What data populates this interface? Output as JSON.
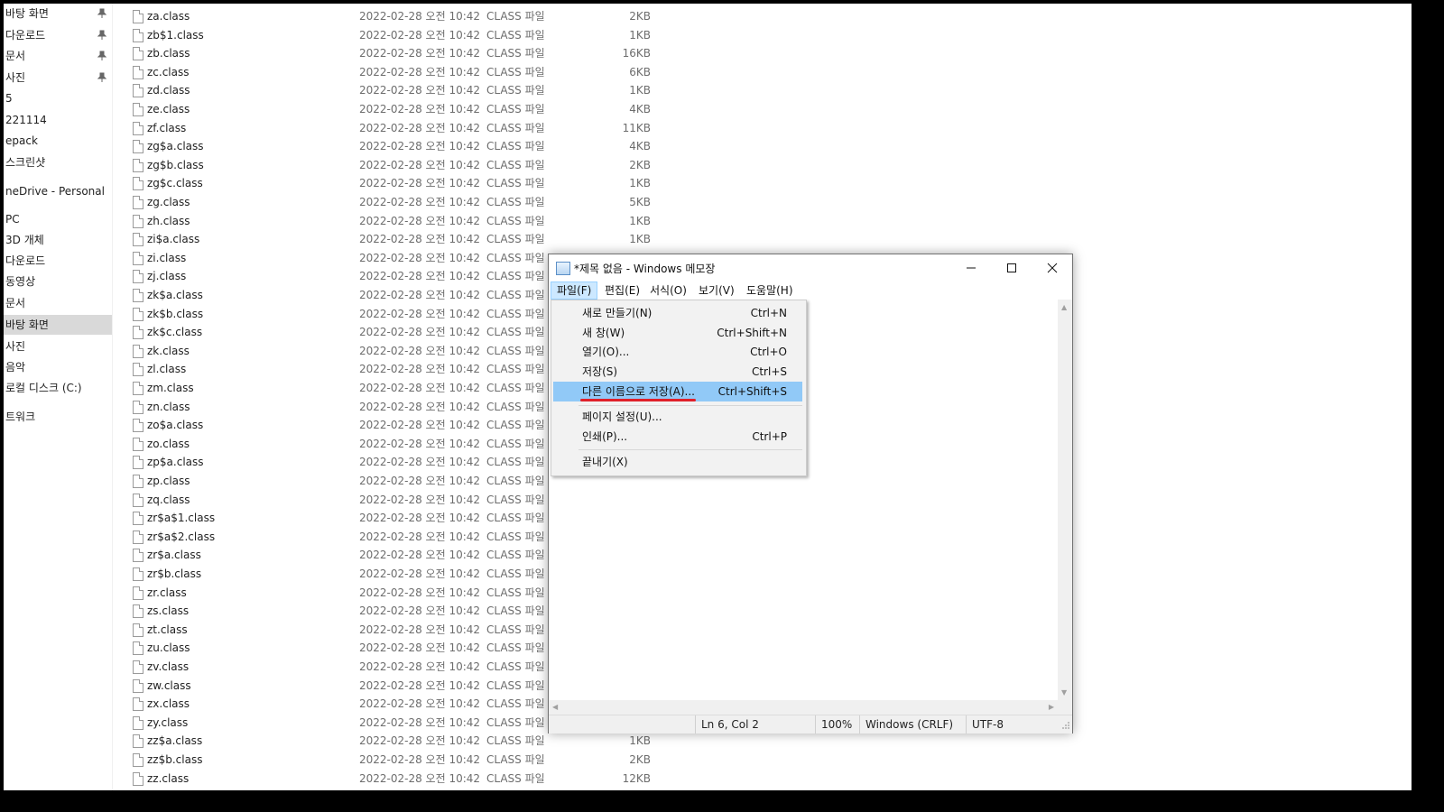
{
  "nav": {
    "items": [
      {
        "label": "바탕 화면",
        "pinned": true
      },
      {
        "label": "다운로드",
        "pinned": true
      },
      {
        "label": "문서",
        "pinned": true
      },
      {
        "label": "사진",
        "pinned": true
      },
      {
        "label": "5",
        "pinned": false
      },
      {
        "label": "221114",
        "pinned": false
      },
      {
        "label": "epack",
        "pinned": false
      },
      {
        "label": "스크린샷",
        "pinned": false
      },
      {
        "label": "neDrive - Personal",
        "pinned": false
      },
      {
        "label": "PC",
        "pinned": false
      },
      {
        "label": "3D 개체",
        "pinned": false
      },
      {
        "label": "다운로드",
        "pinned": false
      },
      {
        "label": "동영상",
        "pinned": false
      },
      {
        "label": "문서",
        "pinned": false
      },
      {
        "label": "바탕 화면",
        "pinned": false,
        "selected": true
      },
      {
        "label": "사진",
        "pinned": false
      },
      {
        "label": "음악",
        "pinned": false
      },
      {
        "label": "로컬 디스크 (C:)",
        "pinned": false
      },
      {
        "label": "트워크",
        "pinned": false
      }
    ]
  },
  "files": [
    {
      "name": "za.class",
      "date": "2022-02-28 오전 10:42",
      "type": "CLASS 파일",
      "size": "2KB"
    },
    {
      "name": "zb$1.class",
      "date": "2022-02-28 오전 10:42",
      "type": "CLASS 파일",
      "size": "1KB"
    },
    {
      "name": "zb.class",
      "date": "2022-02-28 오전 10:42",
      "type": "CLASS 파일",
      "size": "16KB"
    },
    {
      "name": "zc.class",
      "date": "2022-02-28 오전 10:42",
      "type": "CLASS 파일",
      "size": "6KB"
    },
    {
      "name": "zd.class",
      "date": "2022-02-28 오전 10:42",
      "type": "CLASS 파일",
      "size": "1KB"
    },
    {
      "name": "ze.class",
      "date": "2022-02-28 오전 10:42",
      "type": "CLASS 파일",
      "size": "4KB"
    },
    {
      "name": "zf.class",
      "date": "2022-02-28 오전 10:42",
      "type": "CLASS 파일",
      "size": "11KB"
    },
    {
      "name": "zg$a.class",
      "date": "2022-02-28 오전 10:42",
      "type": "CLASS 파일",
      "size": "4KB"
    },
    {
      "name": "zg$b.class",
      "date": "2022-02-28 오전 10:42",
      "type": "CLASS 파일",
      "size": "2KB"
    },
    {
      "name": "zg$c.class",
      "date": "2022-02-28 오전 10:42",
      "type": "CLASS 파일",
      "size": "1KB"
    },
    {
      "name": "zg.class",
      "date": "2022-02-28 오전 10:42",
      "type": "CLASS 파일",
      "size": "5KB"
    },
    {
      "name": "zh.class",
      "date": "2022-02-28 오전 10:42",
      "type": "CLASS 파일",
      "size": "1KB"
    },
    {
      "name": "zi$a.class",
      "date": "2022-02-28 오전 10:42",
      "type": "CLASS 파일",
      "size": "1KB"
    },
    {
      "name": "zi.class",
      "date": "2022-02-28 오전 10:42",
      "type": "CLASS 파일",
      "size": ""
    },
    {
      "name": "zj.class",
      "date": "2022-02-28 오전 10:42",
      "type": "CLASS 파일",
      "size": ""
    },
    {
      "name": "zk$a.class",
      "date": "2022-02-28 오전 10:42",
      "type": "CLASS 파일",
      "size": ""
    },
    {
      "name": "zk$b.class",
      "date": "2022-02-28 오전 10:42",
      "type": "CLASS 파일",
      "size": ""
    },
    {
      "name": "zk$c.class",
      "date": "2022-02-28 오전 10:42",
      "type": "CLASS 파일",
      "size": ""
    },
    {
      "name": "zk.class",
      "date": "2022-02-28 오전 10:42",
      "type": "CLASS 파일",
      "size": ""
    },
    {
      "name": "zl.class",
      "date": "2022-02-28 오전 10:42",
      "type": "CLASS 파일",
      "size": ""
    },
    {
      "name": "zm.class",
      "date": "2022-02-28 오전 10:42",
      "type": "CLASS 파일",
      "size": ""
    },
    {
      "name": "zn.class",
      "date": "2022-02-28 오전 10:42",
      "type": "CLASS 파일",
      "size": ""
    },
    {
      "name": "zo$a.class",
      "date": "2022-02-28 오전 10:42",
      "type": "CLASS 파일",
      "size": ""
    },
    {
      "name": "zo.class",
      "date": "2022-02-28 오전 10:42",
      "type": "CLASS 파일",
      "size": ""
    },
    {
      "name": "zp$a.class",
      "date": "2022-02-28 오전 10:42",
      "type": "CLASS 파일",
      "size": ""
    },
    {
      "name": "zp.class",
      "date": "2022-02-28 오전 10:42",
      "type": "CLASS 파일",
      "size": ""
    },
    {
      "name": "zq.class",
      "date": "2022-02-28 오전 10:42",
      "type": "CLASS 파일",
      "size": ""
    },
    {
      "name": "zr$a$1.class",
      "date": "2022-02-28 오전 10:42",
      "type": "CLASS 파일",
      "size": ""
    },
    {
      "name": "zr$a$2.class",
      "date": "2022-02-28 오전 10:42",
      "type": "CLASS 파일",
      "size": ""
    },
    {
      "name": "zr$a.class",
      "date": "2022-02-28 오전 10:42",
      "type": "CLASS 파일",
      "size": ""
    },
    {
      "name": "zr$b.class",
      "date": "2022-02-28 오전 10:42",
      "type": "CLASS 파일",
      "size": ""
    },
    {
      "name": "zr.class",
      "date": "2022-02-28 오전 10:42",
      "type": "CLASS 파일",
      "size": ""
    },
    {
      "name": "zs.class",
      "date": "2022-02-28 오전 10:42",
      "type": "CLASS 파일",
      "size": ""
    },
    {
      "name": "zt.class",
      "date": "2022-02-28 오전 10:42",
      "type": "CLASS 파일",
      "size": ""
    },
    {
      "name": "zu.class",
      "date": "2022-02-28 오전 10:42",
      "type": "CLASS 파일",
      "size": ""
    },
    {
      "name": "zv.class",
      "date": "2022-02-28 오전 10:42",
      "type": "CLASS 파일",
      "size": ""
    },
    {
      "name": "zw.class",
      "date": "2022-02-28 오전 10:42",
      "type": "CLASS 파일",
      "size": ""
    },
    {
      "name": "zx.class",
      "date": "2022-02-28 오전 10:42",
      "type": "CLASS 파일",
      "size": ""
    },
    {
      "name": "zy.class",
      "date": "2022-02-28 오전 10:42",
      "type": "CLASS 파일",
      "size": ""
    },
    {
      "name": "zz$a.class",
      "date": "2022-02-28 오전 10:42",
      "type": "CLASS 파일",
      "size": "1KB"
    },
    {
      "name": "zz$b.class",
      "date": "2022-02-28 오전 10:42",
      "type": "CLASS 파일",
      "size": "2KB"
    },
    {
      "name": "zz.class",
      "date": "2022-02-28 오전 10:42",
      "type": "CLASS 파일",
      "size": "12KB"
    }
  ],
  "notepad": {
    "title": "*제목 없음 - Windows 메모장",
    "menus": [
      "파일(F)",
      "편집(E)",
      "서식(O)",
      "보기(V)",
      "도움말(H)"
    ],
    "active_menu": "파일(F)",
    "file_menu": {
      "group1": [
        {
          "label": "새로 만들기(N)",
          "shortcut": "Ctrl+N"
        },
        {
          "label": "새 창(W)",
          "shortcut": "Ctrl+Shift+N"
        },
        {
          "label": "열기(O)...",
          "shortcut": "Ctrl+O"
        },
        {
          "label": "저장(S)",
          "shortcut": "Ctrl+S"
        },
        {
          "label": "다른 이름으로 저장(A)...",
          "shortcut": "Ctrl+Shift+S",
          "highlighted": true
        }
      ],
      "group2": [
        {
          "label": "페이지 설정(U)...",
          "shortcut": ""
        },
        {
          "label": "인쇄(P)...",
          "shortcut": "Ctrl+P"
        }
      ],
      "group3": [
        {
          "label": "끝내기(X)",
          "shortcut": ""
        }
      ]
    },
    "status": {
      "position": "Ln 6, Col 2",
      "zoom": "100%",
      "line_ending": "Windows (CRLF)",
      "encoding": "UTF-8"
    }
  },
  "colors": {
    "selection": "#91c9f7",
    "menu_active": "#cce8ff",
    "annotation_underline": "#e0202a",
    "nav_selected": "#d9d9d9"
  }
}
